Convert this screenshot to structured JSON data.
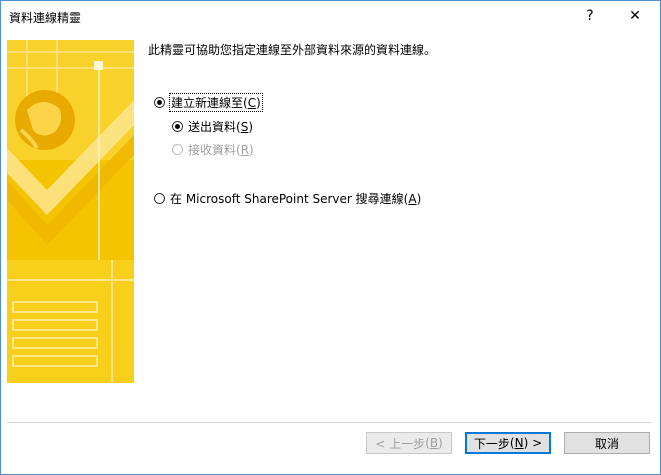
{
  "window": {
    "title": "資料連線精靈",
    "help_glyph": "?",
    "close_glyph": "✕"
  },
  "main": {
    "description": "此精靈可協助您指定連線至外部資料來源的資料連線。",
    "options": {
      "new_connection": {
        "text": "建立新連線至",
        "key": "C",
        "selected": true
      },
      "send_data": {
        "text": "送出資料",
        "key": "S",
        "selected": true
      },
      "receive_data": {
        "text": "接收資料",
        "key": "R",
        "selected": false,
        "disabled": true
      },
      "sharepoint": {
        "text": "在 Microsoft SharePoint Server 搜尋連線",
        "key": "A",
        "selected": false
      }
    }
  },
  "footer": {
    "back": {
      "text": "< 上一步",
      "key": "B",
      "disabled": true
    },
    "next": {
      "text": "下一步",
      "key": "N",
      "suffix": " >"
    },
    "cancel": {
      "text": "取消"
    }
  },
  "colors": {
    "accent_border": "#4f8fd0",
    "art_yellow": "#f7c800",
    "art_light": "#ffe36e",
    "default_button": "#0078d7"
  }
}
